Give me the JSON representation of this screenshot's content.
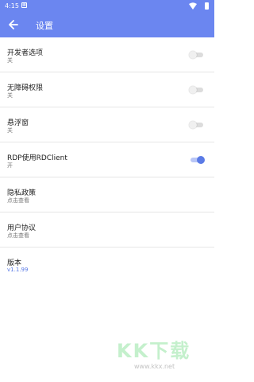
{
  "status_bar": {
    "time": "4:15",
    "notification_icon": "notification-square-icon",
    "wifi_icon": "wifi-icon",
    "battery_icon": "battery-icon",
    "background": "#6b86f0"
  },
  "app_bar": {
    "back_icon": "arrow-left-icon",
    "title": "设置",
    "background": "#6b86f0"
  },
  "settings": [
    {
      "label": "开发者选项",
      "sub": "关",
      "toggle": false
    },
    {
      "label": "无障碍权限",
      "sub": "关",
      "toggle": false
    },
    {
      "label": "悬浮窗",
      "sub": "关",
      "toggle": false
    },
    {
      "label": "RDP使用RDClient",
      "sub": "开",
      "toggle": true
    },
    {
      "label": "隐私政策",
      "sub": "点击查看"
    },
    {
      "label": "用户协议",
      "sub": "点击查看"
    },
    {
      "label": "版本",
      "sub": "v1.1.99"
    }
  ],
  "colors": {
    "accent": "#5b7be6"
  },
  "watermark": {
    "logo": "KK下载",
    "url": "www.kkx.net"
  }
}
